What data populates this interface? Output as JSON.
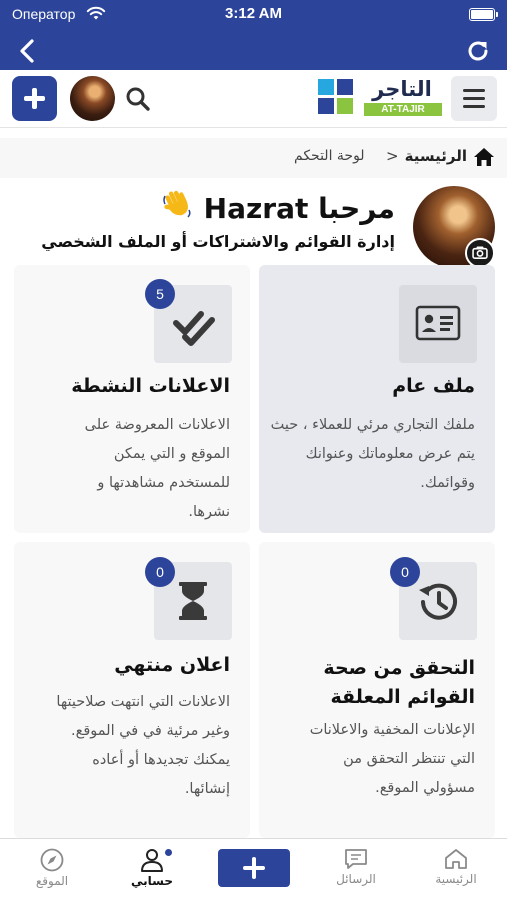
{
  "status_bar": {
    "carrier": "Оператор",
    "time": "3:12 AM"
  },
  "header": {
    "logo_arabic": "التاجر",
    "logo_english": "AT-TAJIR"
  },
  "breadcrumb": {
    "home": "الرئيسية",
    "separator": ">",
    "current": "لوحة التحكم"
  },
  "greeting": {
    "title": "مرحبا Hazrat",
    "subtitle": "إدارة القوائم والاشتراكات أو الملف الشخصي"
  },
  "cards": [
    {
      "title": "ملف عام",
      "description": "ملفك التجاري مرئي للعملاء ، حيث يتم عرض معلوماتك وعنوانك وقوائمك.",
      "icon": "id-card-icon",
      "badge": null
    },
    {
      "title": "الاعلانات النشطة",
      "description": "الاعلانات المعروضة على الموقع و التي يمكن للمستخدم مشاهدتها و نشرها.",
      "icon": "double-check-icon",
      "badge": "5"
    },
    {
      "title": "التحقق من صحة القوائم المعلقة",
      "description": "الإعلانات المخفية والاعلانات التي تنتظر التحقق من مسؤولي الموقع.",
      "icon": "history-icon",
      "badge": "0"
    },
    {
      "title": "اعلان منتهي",
      "description": "الاعلانات التي انتهت صلاحيتها وغير مرئية في في الموقع. يمكنك تجديدها أو أعاده إنشائها.",
      "icon": "hourglass-icon",
      "badge": "0"
    }
  ],
  "tabbar": {
    "home": "الرئيسية",
    "messages": "الرسائل",
    "account": "حسابي",
    "site": "الموقع"
  },
  "colors": {
    "brand": "#2c459a",
    "active_card": "#e7e9ef"
  }
}
